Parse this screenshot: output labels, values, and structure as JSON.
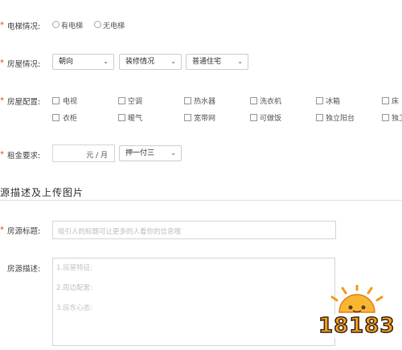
{
  "elevator": {
    "label": "电梯情况:",
    "options": [
      "有电梯",
      "无电梯"
    ]
  },
  "house": {
    "label": "房屋情况:",
    "selects": [
      "朝向",
      "装修情况",
      "普通住宅"
    ]
  },
  "config": {
    "label": "房屋配置:",
    "row1": [
      "电视",
      "空调",
      "热水器",
      "洗衣机",
      "冰箱",
      "床"
    ],
    "row2": [
      "衣柜",
      "暖气",
      "宽带网",
      "可做饭",
      "独立阳台",
      "独卫"
    ]
  },
  "rent": {
    "label": "租金要求:",
    "unit": "元 / 月",
    "payment": "押一付三"
  },
  "section": {
    "title": "源描述及上传图片"
  },
  "listing_title": {
    "label": "房源标题:",
    "placeholder": "吸引人的标题可让更多的人看你的信息哦"
  },
  "description": {
    "label": "房源描述:",
    "lines": [
      "1.房屋特征:",
      "2.周边配套:",
      "3.房东心态:"
    ]
  },
  "watermark": {
    "text": "18183"
  }
}
